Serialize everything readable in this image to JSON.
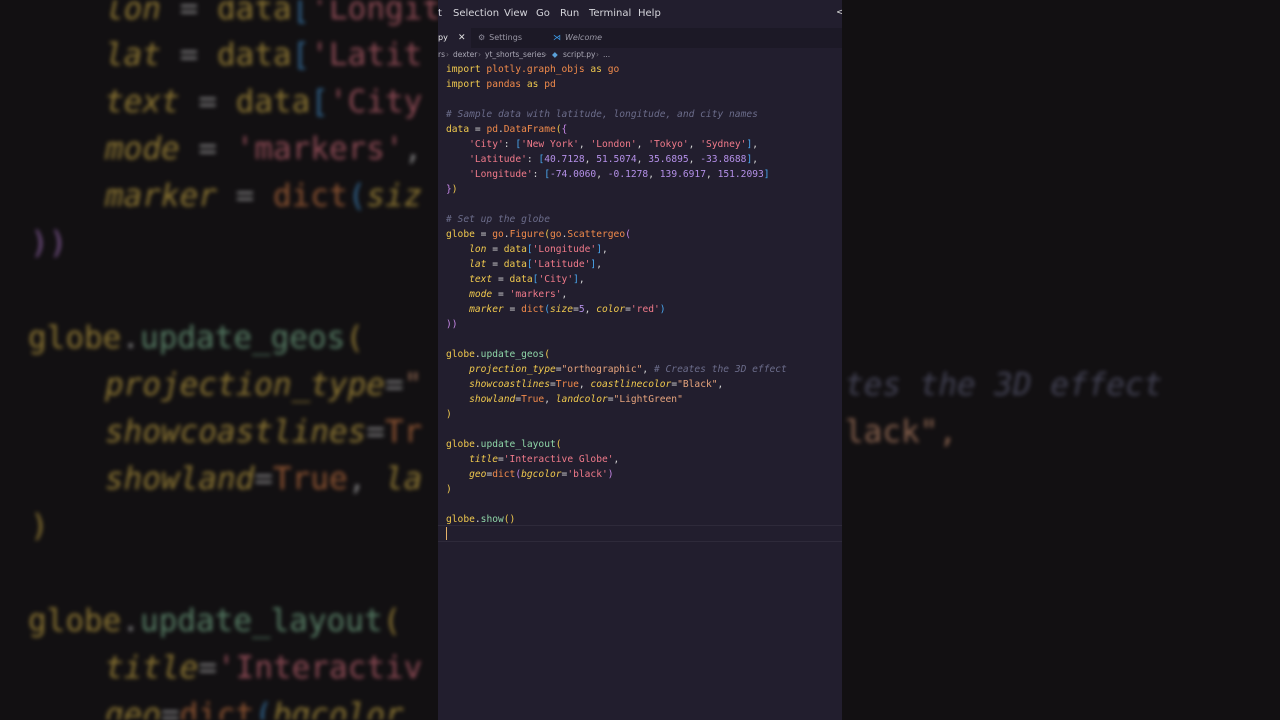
{
  "menubar": {
    "items": [
      "t",
      "Selection",
      "View",
      "Go",
      "Run",
      "Terminal",
      "Help"
    ],
    "close_glyph": "<"
  },
  "tabs": {
    "active": {
      "label": "py",
      "close_glyph": "✕"
    },
    "settings": {
      "label": "Settings",
      "icon": "gear-icon"
    },
    "welcome": {
      "label": "Welcome",
      "icon": "vscode-logo-icon"
    }
  },
  "breadcrumb": {
    "parts": [
      "rs",
      "dexter",
      "yt_shorts_series",
      "script.py",
      "..."
    ],
    "separator": "›",
    "file_icon": "python-file-icon"
  },
  "code": {
    "line1": [
      "import",
      " plotly.graph_objs",
      " as",
      " go"
    ],
    "line2": [
      "import",
      " pandas",
      " as",
      " pd"
    ],
    "line4": "# Sample data with latitude, longitude, and city names",
    "line5": [
      "data",
      " = ",
      "pd",
      ".",
      "DataFrame",
      "(",
      "{"
    ],
    "line6": [
      "'City'",
      ": ",
      "[",
      "'New York'",
      ", ",
      "'London'",
      ", ",
      "'Tokyo'",
      ", ",
      "'Sydney'",
      "]",
      ","
    ],
    "line7": [
      "'Latitude'",
      ": ",
      "[",
      "40.7128",
      ", ",
      "51.5074",
      ", ",
      "35.6895",
      ", ",
      "-33.8688",
      "]",
      ","
    ],
    "line8": [
      "'Longitude'",
      ": ",
      "[",
      "-74.0060",
      ", ",
      "-0.1278",
      ", ",
      "139.6917",
      ", ",
      "151.2093",
      "]"
    ],
    "line9": [
      "}",
      ")"
    ],
    "line11": "# Set up the globe",
    "line12": [
      "globe",
      " = ",
      "go",
      ".",
      "Figure",
      "(",
      "go",
      ".",
      "Scattergeo",
      "("
    ],
    "line13": [
      "lon",
      " = ",
      "data",
      "[",
      "'Longitude'",
      "]",
      ","
    ],
    "line14": [
      "lat",
      " = ",
      "data",
      "[",
      "'Latitude'",
      "]",
      ","
    ],
    "line15": [
      "text",
      " = ",
      "data",
      "[",
      "'City'",
      "]",
      ","
    ],
    "line16": [
      "mode",
      " = ",
      "'markers'",
      ","
    ],
    "line17": [
      "marker",
      " = ",
      "dict",
      "(",
      "size",
      "=",
      "5",
      ", ",
      "color",
      "=",
      "'red'",
      ")"
    ],
    "line18": [
      "))"
    ],
    "line20": [
      "globe",
      ".",
      "update_geos",
      "("
    ],
    "line21": [
      "projection_type",
      "=",
      "\"orthographic\"",
      ", ",
      "# Creates the 3D effect"
    ],
    "line22": [
      "showcoastlines",
      "=",
      "True",
      ", ",
      "coastlinecolor",
      "=",
      "\"Black\"",
      ","
    ],
    "line23": [
      "showland",
      "=",
      "True",
      ", ",
      "landcolor",
      "=",
      "\"LightGreen\""
    ],
    "line24": [
      ")"
    ],
    "line26": [
      "globe",
      ".",
      "update_layout",
      "("
    ],
    "line27": [
      "title",
      "=",
      "'Interactive Globe'",
      ","
    ],
    "line28": [
      "geo",
      "=",
      "dict",
      "(",
      "bgcolor",
      "=",
      "'black'",
      ")"
    ],
    "line29": [
      ")"
    ],
    "line31": [
      "globe",
      ".",
      "show",
      "()"
    ]
  },
  "background": {
    "left": {
      "l1": [
        "lon",
        " = ",
        "data",
        "[",
        "'Longit"
      ],
      "l2": [
        "lat",
        " = ",
        "data",
        "[",
        "'Latit"
      ],
      "l3": [
        "text",
        " = ",
        "data",
        "[",
        "'City"
      ],
      "l4": [
        "mode",
        " = ",
        "'markers'",
        ","
      ],
      "l5": [
        "marker",
        " = ",
        "dict",
        "(",
        "siz"
      ],
      "l6": "))",
      "l7": [
        "globe",
        ".",
        "update_geos",
        "("
      ],
      "l8": [
        "projection_type",
        "=",
        "\""
      ],
      "l9": [
        "showcoastlines",
        "=",
        "Tr"
      ],
      "l10": [
        "showland",
        "=",
        "True",
        ", ",
        "la"
      ],
      "l11": ")",
      "l12": [
        "globe",
        ".",
        "update_layout",
        "("
      ],
      "l13": [
        "title",
        "=",
        "'Interactiv"
      ],
      "l14": [
        "geo",
        "=",
        "dict",
        "(",
        "bgcolor"
      ]
    },
    "right": {
      "r1": "tes the 3D effect",
      "r2": "lack\","
    }
  },
  "colors": {
    "editor_bg": "#221e2e",
    "keyword": "#f0c94e",
    "module": "#f08a4b",
    "string": "#f07a8a",
    "number": "#b490e8",
    "comment": "#6b6c8a",
    "method": "#8fd6a8"
  }
}
